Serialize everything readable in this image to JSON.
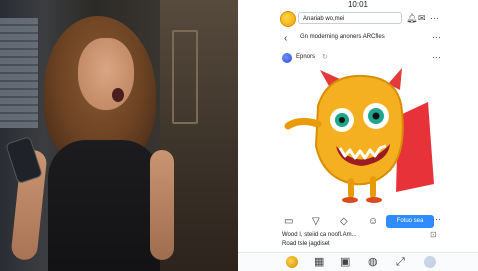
{
  "status": {
    "time": "10:01"
  },
  "header": {
    "search_text": "Anariab wo,mei",
    "icons": [
      "profile-avatar",
      "bell-icon",
      "messages-icon",
      "more-icon"
    ]
  },
  "post_toolbar": {
    "back_icon": "chevron-left-icon",
    "crumb": "Gn moderning anoners ARCfles",
    "more_icon": "more-icon"
  },
  "author": {
    "name": "Epnors",
    "badge_icon": "verified-icon",
    "more_icon": "more-icon"
  },
  "artwork": {
    "subject": "orange-cartoon-monster",
    "accent": "#f0a400",
    "cape": "#e8323a"
  },
  "actions": {
    "follow_label": "Fotuo sea",
    "icons": [
      "bookmark-icon",
      "send-icon",
      "heart-icon",
      "emoji-icon",
      "more-icon"
    ]
  },
  "caption": {
    "line1": "Wood I,  steiid ca noofl.Am...",
    "line2": "Road tsle jagdiset"
  },
  "bottom_nav": {
    "icons": [
      "profile-avatar",
      "library-icon",
      "video-icon",
      "globe-icon",
      "expand-icon",
      "profile-circle"
    ]
  },
  "colors": {
    "accent": "#2f8cff",
    "monster": "#f4b020",
    "horn": "#e33a3a"
  }
}
